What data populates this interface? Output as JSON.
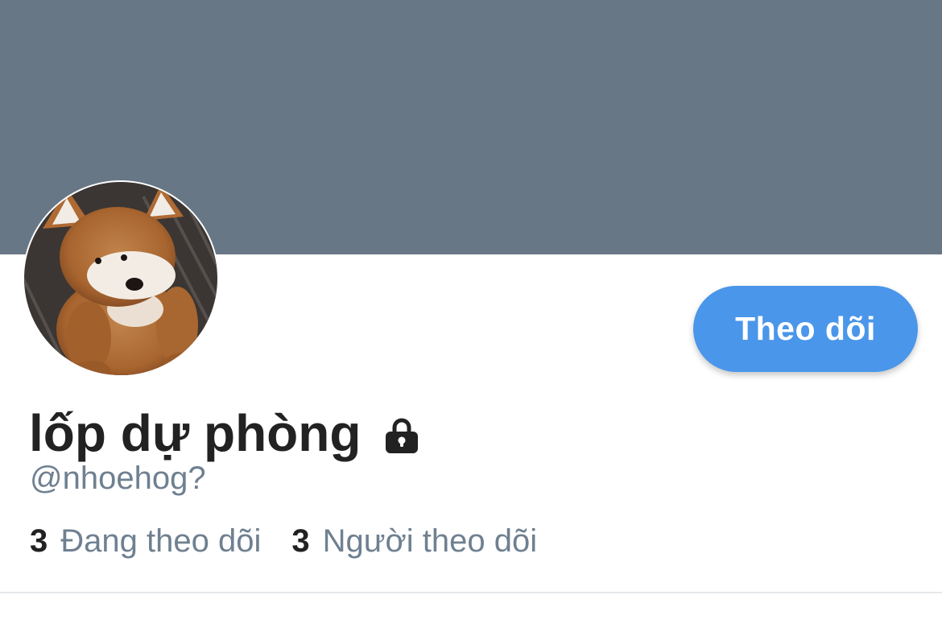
{
  "profile": {
    "display_name": "lốp dự phòng",
    "handle": "@nhoehog?",
    "protected": true,
    "lock_icon": "lock-icon",
    "avatar_icon": "stuffed-fox-avatar"
  },
  "actions": {
    "follow_label": "Theo dõi"
  },
  "stats": {
    "following_count": "3",
    "following_label": "Đang theo dõi",
    "followers_count": "3",
    "followers_label": "Người theo dõi"
  },
  "colors": {
    "banner": "#687786",
    "follow_button": "#4a96ea",
    "text_primary": "#222222",
    "text_secondary": "#6f8090"
  }
}
